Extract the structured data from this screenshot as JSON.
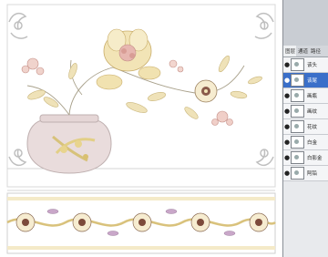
{
  "panel": {
    "tabs": [
      "图层",
      "通道",
      "路径"
    ],
    "layers": [
      {
        "name": "该头",
        "selected": false
      },
      {
        "name": "该尾",
        "selected": true
      },
      {
        "name": "画瓶",
        "selected": false
      },
      {
        "name": "画纹",
        "selected": false
      },
      {
        "name": "花纹",
        "selected": false
      },
      {
        "name": "白金",
        "selected": false
      },
      {
        "name": "白影金",
        "selected": false
      },
      {
        "name": "阿铅",
        "selected": false
      }
    ]
  },
  "colors": {
    "canvas_bg": "#ffffff",
    "vase": "#e9dcdc",
    "flower_gold": "#e9d39a",
    "flower_pink": "#e7b7b0",
    "leaf": "#efe2b8",
    "border_outline": "#cfcfcf",
    "selection_blue": "#3a6fc9"
  }
}
